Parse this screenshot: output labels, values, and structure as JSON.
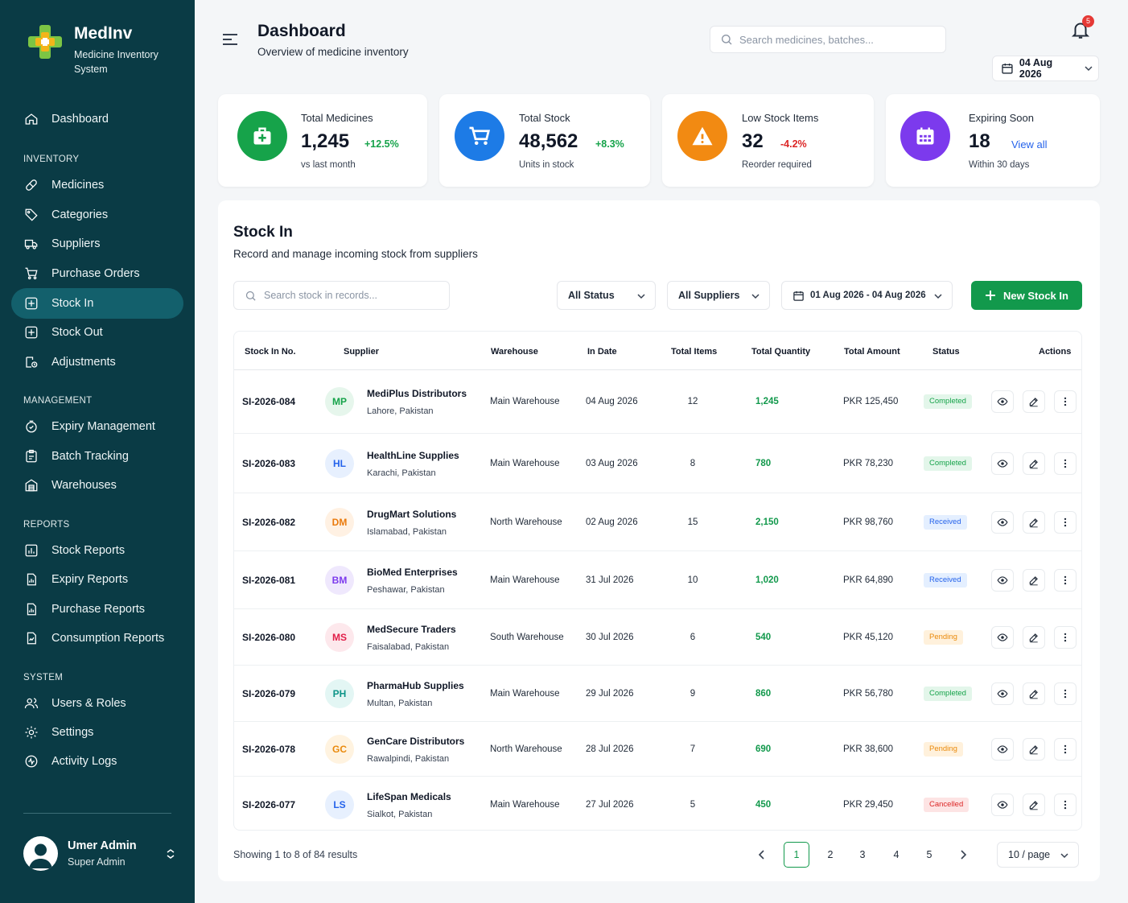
{
  "app": {
    "name": "MedInv",
    "subtitle": "Medicine Inventory System"
  },
  "nav": {
    "dashboard": "Dashboard",
    "sections": {
      "inventory": "INVENTORY",
      "management": "MANAGEMENT",
      "reports": "REPORTS",
      "system": "SYSTEM"
    },
    "items": {
      "medicines": "Medicines",
      "categories": "Categories",
      "suppliers": "Suppliers",
      "purchase_orders": "Purchase Orders",
      "stock_in": "Stock In",
      "stock_out": "Stock Out",
      "adjustments": "Adjustments",
      "expiry_management": "Expiry Management",
      "batch_tracking": "Batch Tracking",
      "warehouses": "Warehouses",
      "stock_reports": "Stock Reports",
      "expiry_reports": "Expiry Reports",
      "purchase_reports": "Purchase Reports",
      "consumption_reports": "Consumption Reports",
      "users_roles": "Users & Roles",
      "settings": "Settings",
      "activity_logs": "Activity Logs"
    },
    "active": "stock_in"
  },
  "user": {
    "name": "Umer Admin",
    "role": "Super Admin"
  },
  "header": {
    "title": "Dashboard",
    "subtitle": "Overview of medicine inventory",
    "search_placeholder": "Search medicines, batches...",
    "notification_count": "5",
    "date": "04 Aug 2026"
  },
  "stats": [
    {
      "label": "Total Medicines",
      "value": "1,245",
      "delta": "+12.5%",
      "note": "vs last month",
      "color": "#16a34a"
    },
    {
      "label": "Total Stock",
      "value": "48,562",
      "delta": "+8.3%",
      "note": "Units in stock",
      "color": "#1d7be6"
    },
    {
      "label": "Low Stock Items",
      "value": "32",
      "delta": "-4.2%",
      "note": "Reorder required",
      "color": "#f28a12"
    },
    {
      "label": "Expiring Soon",
      "value": "18",
      "delta": "View all",
      "note": "Within 30 days",
      "color": "#7c3aed"
    }
  ],
  "stock_in": {
    "title": "Stock In",
    "subtitle": "Record and manage incoming stock from suppliers",
    "search_placeholder": "Search stock in records...",
    "status_filter": "All Status",
    "supplier_filter": "All Suppliers",
    "date_range": "01 Aug 2026 - 04 Aug 2026",
    "new_button": "New Stock In",
    "columns": [
      "Stock In No.",
      "Supplier",
      "Warehouse",
      "In Date",
      "Total Items",
      "Total Quantity",
      "Total Amount",
      "Status",
      "Actions"
    ],
    "rows": [
      {
        "id": "SI-2026-084",
        "initials": "MP",
        "supplier": "MediPlus Distributors",
        "location": "Lahore, Pakistan",
        "warehouse": "Main Warehouse",
        "date": "04 Aug 2026",
        "items": "12",
        "quantity": "1,245",
        "amount": "PKR 125,450",
        "status": "Completed"
      },
      {
        "id": "SI-2026-083",
        "initials": "HL",
        "supplier": "HealthLine Supplies",
        "location": "Karachi, Pakistan",
        "warehouse": "Main Warehouse",
        "date": "03 Aug 2026",
        "items": "8",
        "quantity": "780",
        "amount": "PKR 78,230",
        "status": "Completed"
      },
      {
        "id": "SI-2026-082",
        "initials": "DM",
        "supplier": "DrugMart Solutions",
        "location": "Islamabad, Pakistan",
        "warehouse": "North Warehouse",
        "date": "02 Aug 2026",
        "items": "15",
        "quantity": "2,150",
        "amount": "PKR 98,760",
        "status": "Received"
      },
      {
        "id": "SI-2026-081",
        "initials": "BM",
        "supplier": "BioMed Enterprises",
        "location": "Peshawar, Pakistan",
        "warehouse": "Main Warehouse",
        "date": "31 Jul 2026",
        "items": "10",
        "quantity": "1,020",
        "amount": "PKR 64,890",
        "status": "Received"
      },
      {
        "id": "SI-2026-080",
        "initials": "MS",
        "supplier": "MedSecure Traders",
        "location": "Faisalabad, Pakistan",
        "warehouse": "South Warehouse",
        "date": "30 Jul 2026",
        "items": "6",
        "quantity": "540",
        "amount": "PKR 45,120",
        "status": "Pending"
      },
      {
        "id": "SI-2026-079",
        "initials": "PH",
        "supplier": "PharmaHub Supplies",
        "location": "Multan, Pakistan",
        "warehouse": "Main Warehouse",
        "date": "29 Jul 2026",
        "items": "9",
        "quantity": "860",
        "amount": "PKR 56,780",
        "status": "Completed"
      },
      {
        "id": "SI-2026-078",
        "initials": "GC",
        "supplier": "GenCare Distributors",
        "location": "Rawalpindi, Pakistan",
        "warehouse": "North Warehouse",
        "date": "28 Jul 2026",
        "items": "7",
        "quantity": "690",
        "amount": "PKR 38,600",
        "status": "Pending"
      },
      {
        "id": "SI-2026-077",
        "initials": "LS",
        "supplier": "LifeSpan Medicals",
        "location": "Sialkot, Pakistan",
        "warehouse": "Main Warehouse",
        "date": "27 Jul 2026",
        "items": "5",
        "quantity": "450",
        "amount": "PKR 29,450",
        "status": "Cancelled"
      }
    ],
    "status_colors": {
      "Completed": {
        "bg": "#e3f6ea",
        "fg": "#16a34a"
      },
      "Received": {
        "bg": "#e4efff",
        "fg": "#2563eb"
      },
      "Pending": {
        "bg": "#fff1dc",
        "fg": "#ea8a0c"
      },
      "Cancelled": {
        "bg": "#fde4e4",
        "fg": "#dc2626"
      }
    },
    "avatar_colors": {
      "MP": {
        "bg": "#e6f6ec",
        "fg": "#16a34a"
      },
      "HL": {
        "bg": "#e7f0fe",
        "fg": "#2563eb"
      },
      "DM": {
        "bg": "#fff1e3",
        "fg": "#ea7a0c"
      },
      "BM": {
        "bg": "#efe8fd",
        "fg": "#7c3aed"
      },
      "MS": {
        "bg": "#fde8ec",
        "fg": "#e11d48"
      },
      "PH": {
        "bg": "#e3f6f4",
        "fg": "#0d9488"
      },
      "GC": {
        "bg": "#fff3e0",
        "fg": "#ea8a0c"
      },
      "LS": {
        "bg": "#e7f0fe",
        "fg": "#2563eb"
      }
    },
    "pagination": {
      "showing": "Showing 1 to 8 of 84 results",
      "pages": [
        "1",
        "2",
        "3",
        "4",
        "5"
      ],
      "current": "1",
      "per_page": "10 / page"
    }
  }
}
